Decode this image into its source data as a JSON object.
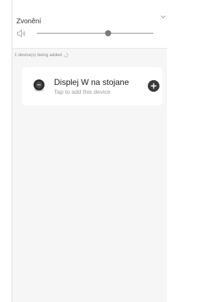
{
  "ringtone": {
    "title": "Zvonění",
    "speaker_icon": "speaker-icon",
    "collapse_icon": "chevron-down-icon",
    "volume_level": 0.61
  },
  "status": {
    "adding_text": "1 device(s) being added",
    "spinner_icon": "loading-spinner-icon"
  },
  "device": {
    "name": "Displej W na stojane",
    "subtitle": "Tap to add this device",
    "thumb_icon": "device-display-icon",
    "add_icon": "plus-icon"
  },
  "colors": {
    "background": "#f6f6f6",
    "card": "#ffffff",
    "accent": "#3a3a3a"
  }
}
